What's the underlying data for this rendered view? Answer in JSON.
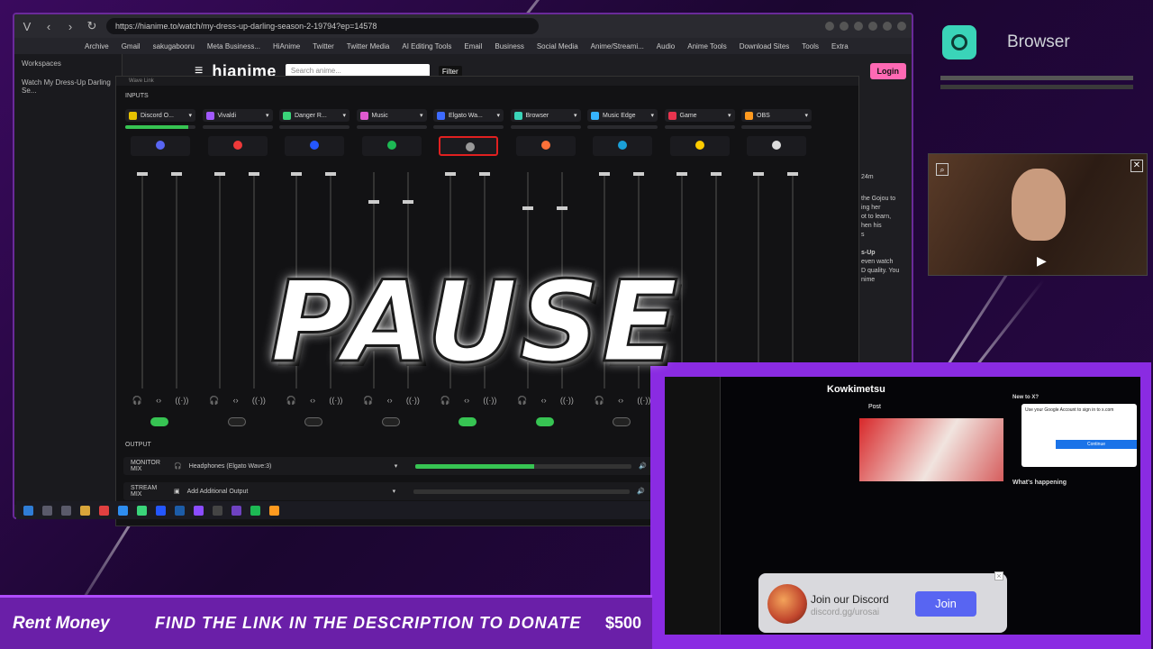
{
  "browser": {
    "url": "https://hianime.to/watch/my-dress-up-darling-season-2-19794?ep=14578",
    "bookmarks": [
      "Archive",
      "Gmail",
      "sakugabooru",
      "Meta Business...",
      "HiAnime",
      "Twitter",
      "Twitter Media",
      "AI Editing Tools",
      "Email",
      "Business",
      "Social Media",
      "Anime/Streami...",
      "Audio",
      "Anime Tools",
      "Download Sites",
      "Tools",
      "Extra"
    ],
    "sidebar": {
      "workspaces": "Workspaces",
      "tab": "Watch My Dress-Up Darling Se..."
    },
    "site": {
      "logo": "hianime",
      "search_placeholder": "Search anime...",
      "filter": "Filter",
      "login": "Login"
    },
    "side_text": [
      "24m",
      "the Gojou to",
      "ing her",
      "ot to learn,",
      "hen his",
      "s",
      "s-Up",
      "even watch",
      "D quality. You",
      "nime"
    ]
  },
  "wavelink": {
    "title": "Wave Link",
    "inputs_label": "INPUTS",
    "outputs_label": "OUTPUT",
    "channels": [
      {
        "name": "Discord O...",
        "color": "#e6c200",
        "level": 0.9,
        "knob": 0.0,
        "toggle": true,
        "muted": false,
        "icon_color": "#5865f2"
      },
      {
        "name": "Vivaldi",
        "color": "#a259ff",
        "level": 0.0,
        "knob": 0.0,
        "toggle": false,
        "muted": false,
        "icon_color": "#ef3939"
      },
      {
        "name": "Danger R...",
        "color": "#3ad47a",
        "level": 0.0,
        "knob": 0.0,
        "toggle": false,
        "muted": false,
        "icon_color": "#2457ff"
      },
      {
        "name": "Music",
        "color": "#e05ad0",
        "level": 0.0,
        "knob": 0.13,
        "toggle": false,
        "muted": false,
        "icon_color": "#1db954"
      },
      {
        "name": "Elgato Wa...",
        "color": "#3e6bff",
        "level": 0.0,
        "knob": 0.0,
        "toggle": true,
        "muted": true,
        "icon_color": "#999999"
      },
      {
        "name": "Browser",
        "color": "#3ad4b8",
        "level": 0.0,
        "knob": 0.16,
        "toggle": true,
        "muted": false,
        "icon_color": "#ff7139"
      },
      {
        "name": "Music Edge",
        "color": "#36b3ff",
        "level": 0.0,
        "knob": 0.0,
        "toggle": false,
        "muted": false,
        "icon_color": "#1aa0d8"
      },
      {
        "name": "Game",
        "color": "#e8344e",
        "level": 0.0,
        "knob": 0.0,
        "toggle": false,
        "muted": false,
        "icon_color": "#ffcc00"
      },
      {
        "name": "OBS",
        "color": "#ff9a1f",
        "level": 0.0,
        "knob": 0.0,
        "toggle": false,
        "muted": false,
        "icon_color": "#dddddd"
      }
    ],
    "outputs": [
      {
        "label": "MONITOR MIX",
        "device": "Headphones (Elgato Wave:3)",
        "level": 0.55
      },
      {
        "label": "STREAM MIX",
        "device": "Add Additional Output",
        "level": 0.0
      }
    ]
  },
  "browser_widget": {
    "title": "Browser"
  },
  "stream": {
    "banner_name": "Rent Money",
    "banner_message": "FIND THE LINK IN THE DESCRIPTION TO DONATE",
    "banner_amount": "$500",
    "pause_text": "PAUSE",
    "twitter_user": "Kowkimetsu",
    "twitter_post": "Post",
    "twitter_new": "New to X?",
    "twitter_happening": "What's happening",
    "signin_text": "Use your Google Account to sign in to x.com",
    "signin_button": "Continue",
    "discord_title": "Join our Discord",
    "discord_sub": "discord.gg/urosai",
    "discord_join": "Join"
  },
  "colors": {
    "accent": "#8a2be2",
    "wave_green": "#37c453",
    "mute_red": "#e02020",
    "login_pink": "#ff69b4"
  }
}
